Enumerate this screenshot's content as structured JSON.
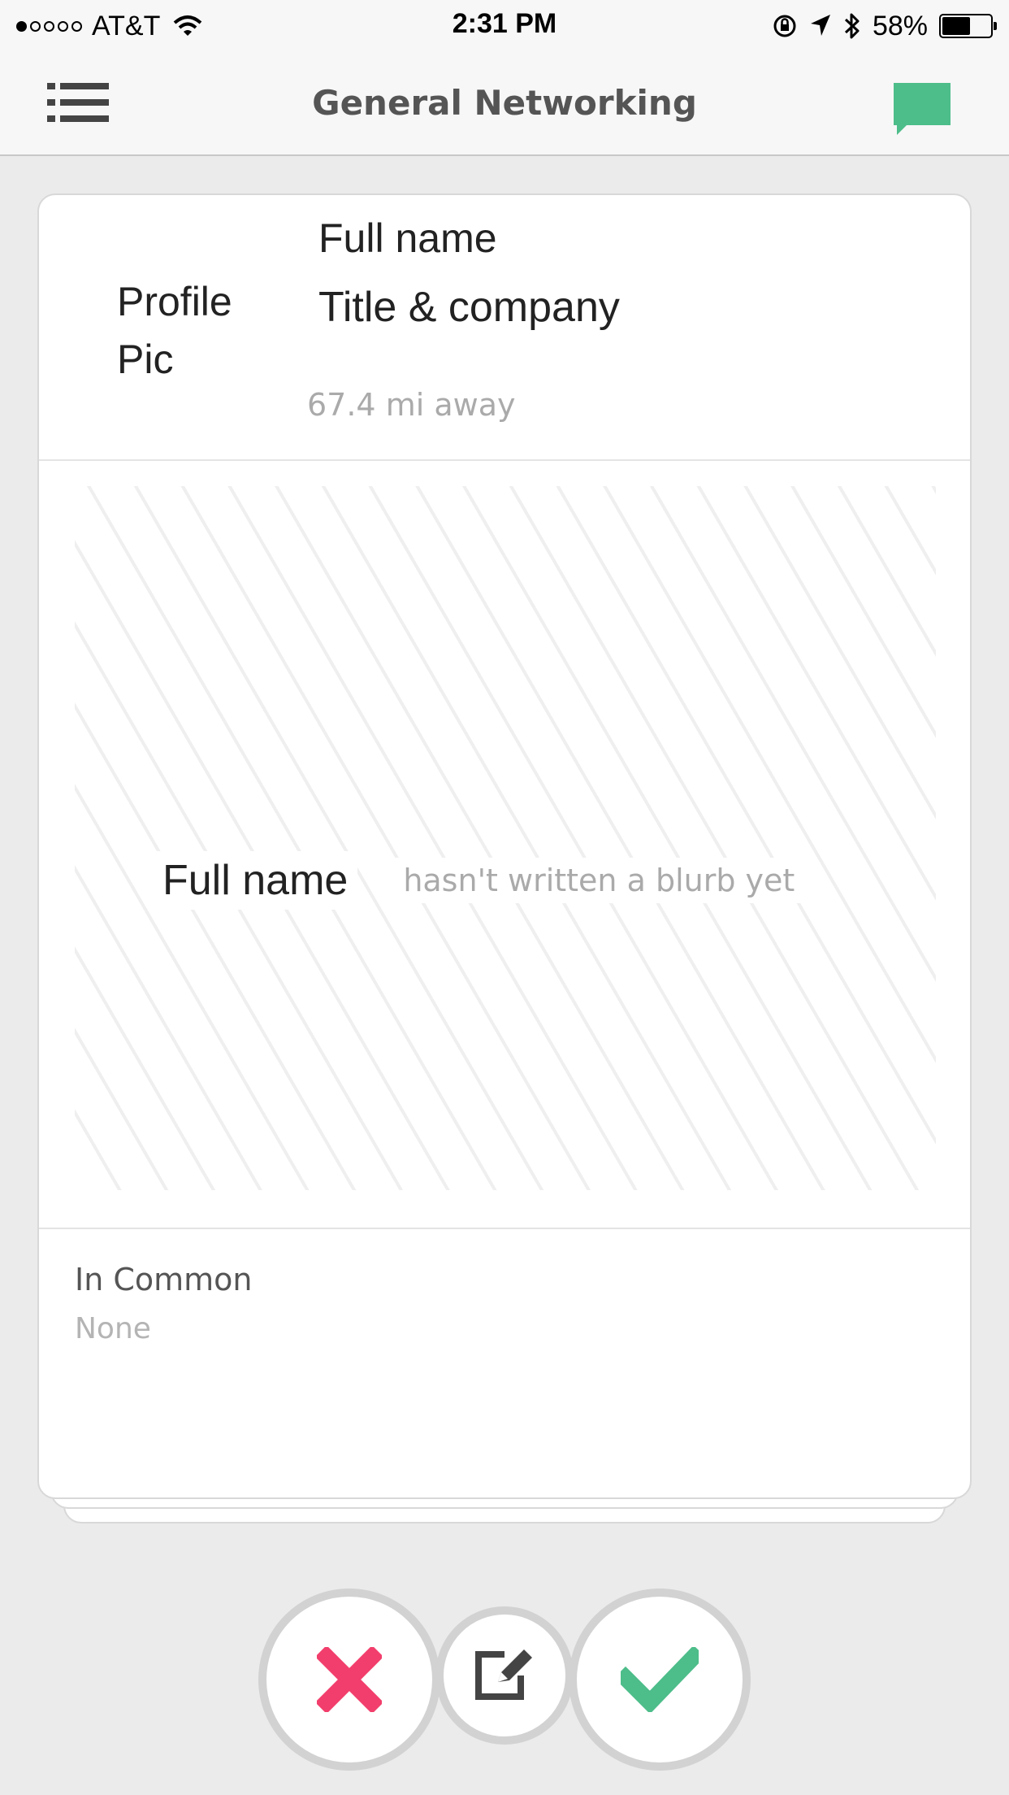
{
  "status_bar": {
    "carrier": "AT&T",
    "signal_dots_filled": 1,
    "signal_dots_total": 5,
    "time": "2:31 PM",
    "battery_percent": "58%",
    "battery_level": 0.58,
    "icons": [
      "wifi-icon",
      "orientation-lock-icon",
      "location-arrow-icon",
      "bluetooth-icon",
      "battery-icon"
    ]
  },
  "nav": {
    "title": "General Networking",
    "menu_icon": "list-menu-icon",
    "chat_icon": "chat-bubble-icon",
    "accent_color": "#4dbd8a"
  },
  "profile": {
    "pic_label": "Profile Pic",
    "full_name": "Full name",
    "title_company": "Title & company",
    "distance": "67.4 mi away"
  },
  "blurb": {
    "name": "Full name",
    "text": "hasn't written a blurb yet"
  },
  "in_common": {
    "title": "In Common",
    "value": "None"
  },
  "actions": {
    "reject_icon": "close-x-icon",
    "reject_color": "#f23e6c",
    "edit_icon": "edit-icon",
    "accept_icon": "checkmark-icon",
    "accept_color": "#4dbd8a"
  }
}
